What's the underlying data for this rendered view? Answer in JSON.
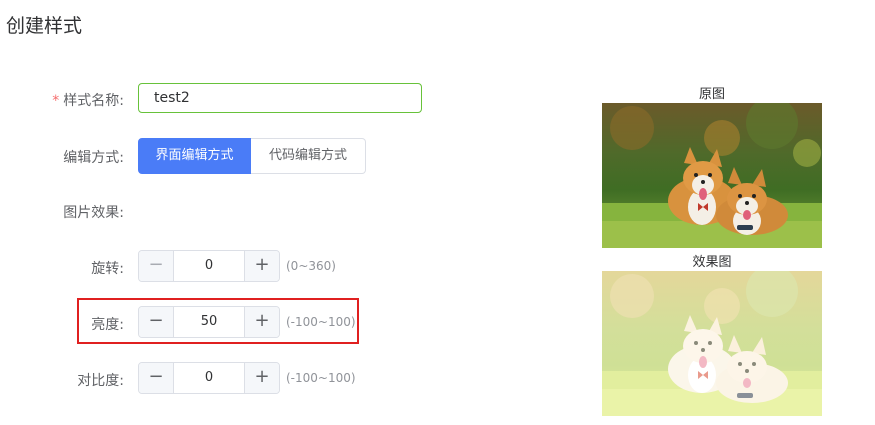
{
  "page": {
    "title": "创建样式"
  },
  "form": {
    "name": {
      "required_mark": "*",
      "label": "样式名称:",
      "value": "test2"
    },
    "edit_mode": {
      "label": "编辑方式:",
      "options": [
        "界面编辑方式",
        "代码编辑方式"
      ],
      "selected": "界面编辑方式"
    },
    "effects_label": "图片效果:",
    "rotate": {
      "label": "旋转:",
      "value": "0",
      "range": "(0~360)",
      "minus": "−",
      "plus": "+"
    },
    "brightness": {
      "label": "亮度:",
      "value": "50",
      "range": "(-100~100)",
      "minus": "−",
      "plus": "+"
    },
    "contrast": {
      "label": "对比度:",
      "value": "0",
      "range": "(-100~100)",
      "minus": "−",
      "plus": "+"
    }
  },
  "preview": {
    "original_caption": "原图",
    "effect_caption": "效果图"
  },
  "colors": {
    "primary": "#4a7cf7",
    "valid_border": "#67c23a",
    "highlight": "#e02020",
    "required": "#f56c6c"
  }
}
